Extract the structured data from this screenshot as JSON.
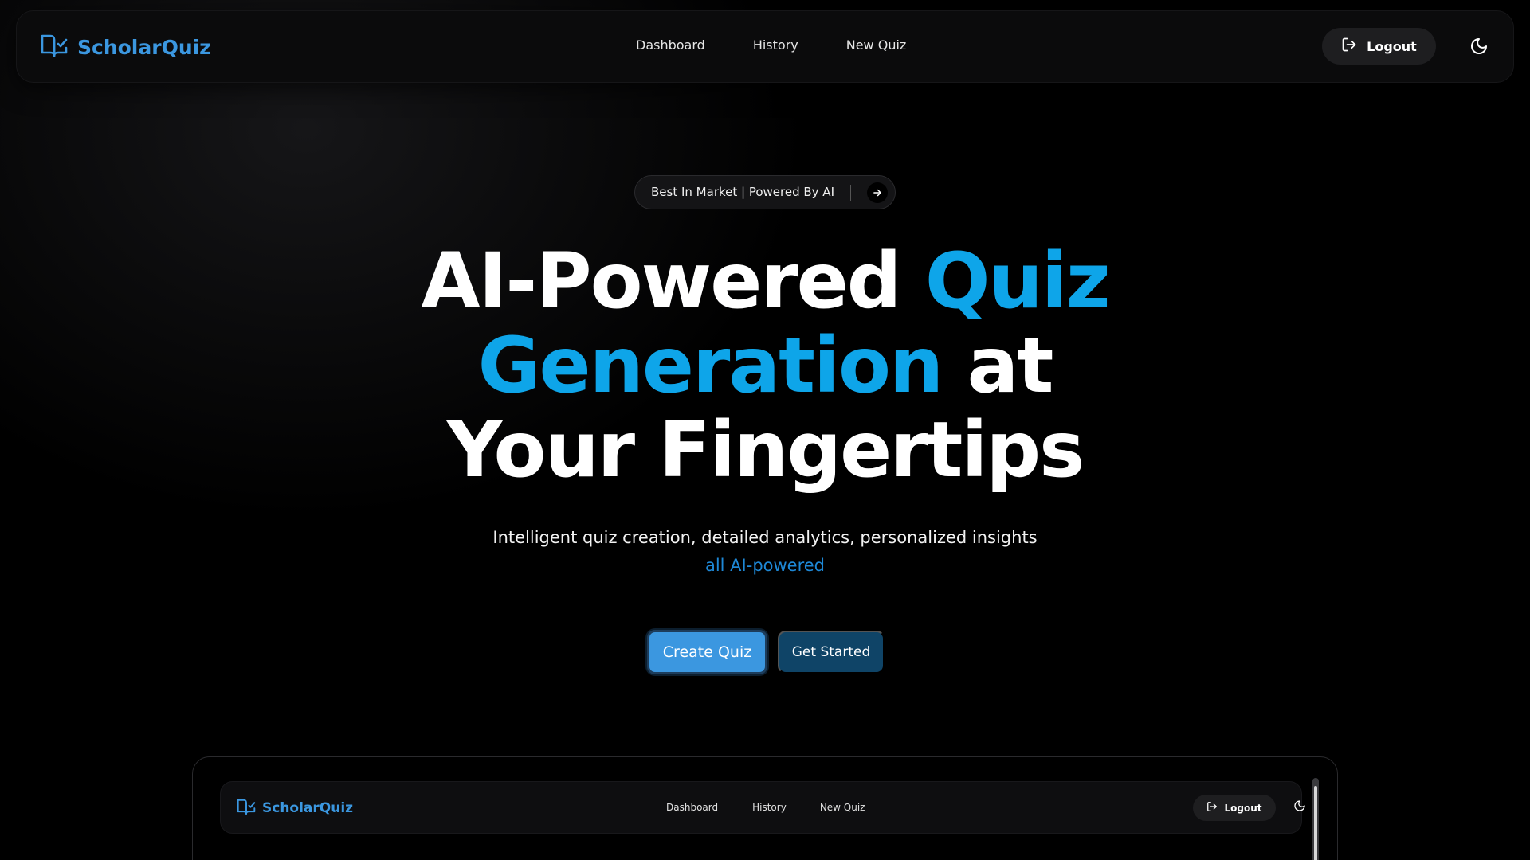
{
  "colors": {
    "accent": "#0ea5e9",
    "brand": "#3b97e0",
    "primary_button": "#3b97e0",
    "secondary_button": "#0f4467",
    "background": "#000000"
  },
  "navbar": {
    "brand_icon": "book-check-icon",
    "brand_name": "ScholarQuiz",
    "links": [
      "Dashboard",
      "History",
      "New Quiz"
    ],
    "logout_icon": "logout-icon",
    "logout_label": "Logout",
    "theme_icon": "moon-icon"
  },
  "hero": {
    "pill_text": "Best In Market | Powered By AI",
    "pill_icon": "arrow-right-icon",
    "headline": {
      "part1": "AI-Powered ",
      "accent1": "Quiz",
      "accent2": "Generation",
      "part2": " at",
      "line3": "Your Fingertips"
    },
    "subtitle": "Intelligent quiz creation, detailed analytics, personalized insights",
    "subtitle_accent": "all AI-powered",
    "primary_cta": "Create Quiz",
    "secondary_cta": "Get Started"
  },
  "preview": {
    "brand_name": "ScholarQuiz",
    "links": [
      "Dashboard",
      "History",
      "New Quiz"
    ],
    "logout_label": "Logout"
  }
}
